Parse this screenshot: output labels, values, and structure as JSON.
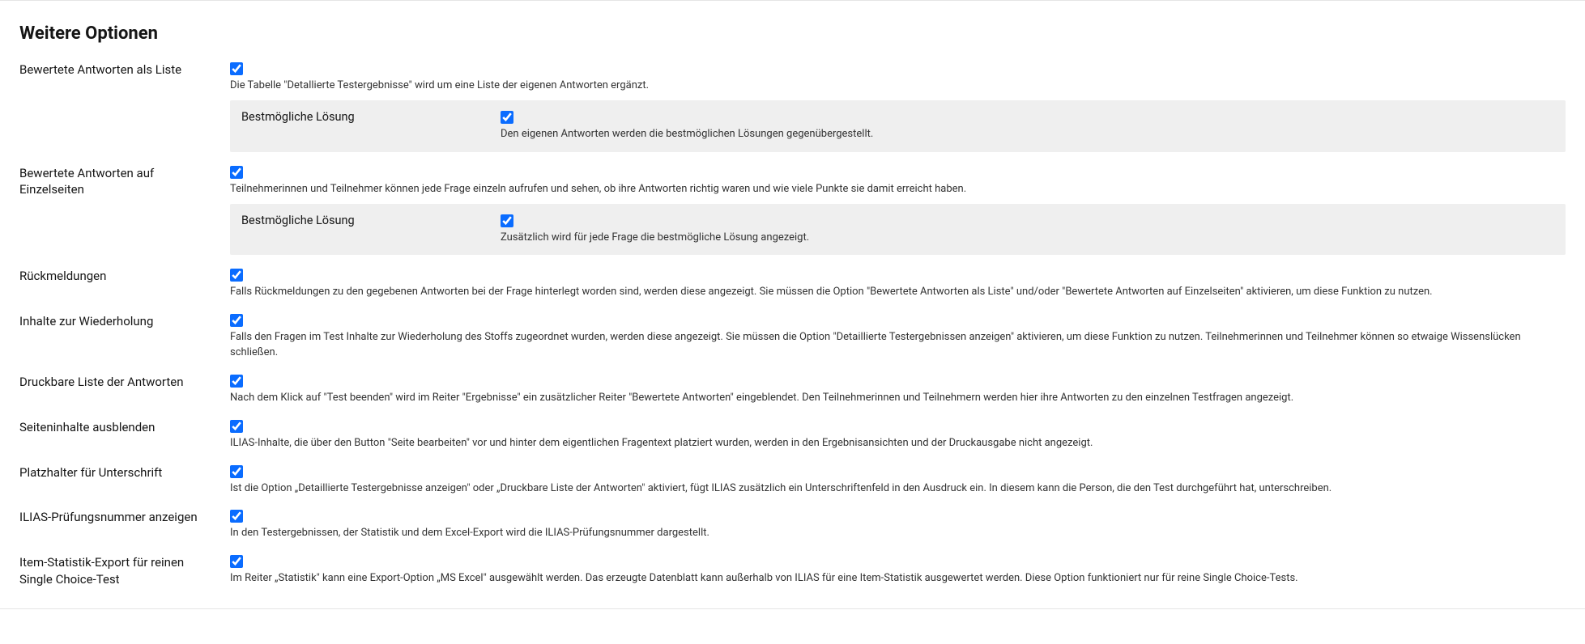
{
  "section_title": "Weitere Optionen",
  "opts": {
    "list": {
      "label": "Bewertete Antworten als Liste",
      "desc": "Die Tabelle \"Detallierte Testergebnisse\" wird um eine Liste der eigenen Antworten ergänzt.",
      "nested": {
        "label": "Bestmögliche Lösung",
        "desc": "Den eigenen Antworten werden die bestmöglichen Lösungen gegenübergestellt."
      }
    },
    "single": {
      "label": "Bewertete Antworten auf Einzelseiten",
      "desc": "Teilnehmerinnen und Teilnehmer können jede Frage einzeln aufrufen und sehen, ob ihre Antworten richtig waren und wie viele Punkte sie damit erreicht haben.",
      "nested": {
        "label": "Bestmögliche Lösung",
        "desc": "Zusätzlich wird für jede Frage die bestmögliche Lösung angezeigt."
      }
    },
    "feedback": {
      "label": "Rückmeldungen",
      "desc": "Falls Rückmeldungen zu den gegebenen Antworten bei der Frage hinterlegt worden sind, werden diese angezeigt. Sie müssen die Option \"Bewertete Antworten als Liste\" und/oder \"Bewertete Antworten auf Einzelseiten\" aktivieren, um diese Funktion zu nutzen."
    },
    "recap": {
      "label": "Inhalte zur Wiederholung",
      "desc": "Falls den Fragen im Test Inhalte zur Wiederholung des Stoffs zugeordnet wurden, werden diese angezeigt. Sie müssen die Option \"Detaillierte Testergebnissen anzeigen\" aktivieren, um diese Funktion zu nutzen. Teilnehmerinnen und Teilnehmer können so etwaige Wissenslücken schließen."
    },
    "printable": {
      "label": "Druckbare Liste der Antworten",
      "desc": "Nach dem Klick auf \"Test beenden\" wird im Reiter \"Ergebnisse\" ein zusätzlicher Reiter \"Bewertete Antworten\" eingeblendet. Den Teilnehmerinnen und Teilnehmern werden hier ihre Antworten zu den einzelnen Testfragen angezeigt."
    },
    "hidepage": {
      "label": "Seiteninhalte ausblenden",
      "desc": "ILIAS-Inhalte, die über den Button \"Seite bearbeiten\" vor und hinter dem eigentlichen Fragentext platziert wurden, werden in den Ergebnisansichten und der Druckausgabe nicht angezeigt."
    },
    "signature": {
      "label": "Platzhalter für Unterschrift",
      "desc": "Ist die Option „Detaillierte Testergebnisse anzeigen\" oder „Druckbare Liste der Antworten\" aktiviert, fügt ILIAS zusätzlich ein Unterschriftenfeld in den Ausdruck ein. In diesem kann die Person, die den Test durchgeführt hat, unterschreiben."
    },
    "examid": {
      "label": "ILIAS-Prüfungsnummer anzeigen",
      "desc": "In den Testergebnissen, der Statistik und dem Excel-Export wird die ILIAS-Prüfungsnummer dargestellt."
    },
    "itemstat": {
      "label": "Item-Statistik-Export für reinen Single Choice-Test",
      "desc": "Im Reiter „Statistik\" kann eine Export-Option „MS Excel\" ausgewählt werden. Das erzeugte Datenblatt kann außerhalb von ILIAS für eine Item-Statistik ausgewertet werden. Diese Option funktioniert nur für reine Single Choice-Tests."
    }
  }
}
